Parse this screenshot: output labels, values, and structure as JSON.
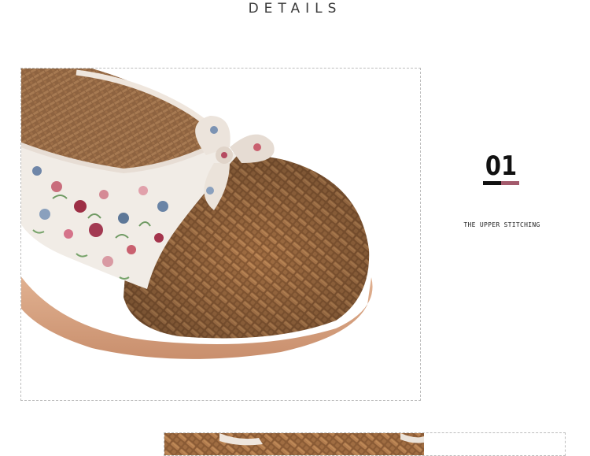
{
  "section": {
    "heading": "DETAILS"
  },
  "detail": {
    "step_number": "01",
    "caption": "THE UPPER STITCHING",
    "underline_colors": [
      "#111111",
      "#a35a6c"
    ]
  },
  "photo": {
    "subject": "woven-slipper-floral-bow"
  },
  "colors": {
    "weave": "#a07045",
    "weave_dark": "#6e4526",
    "sole": "#d8a98a",
    "fabric": "#f1ece6",
    "accent": "#a35a6c"
  }
}
